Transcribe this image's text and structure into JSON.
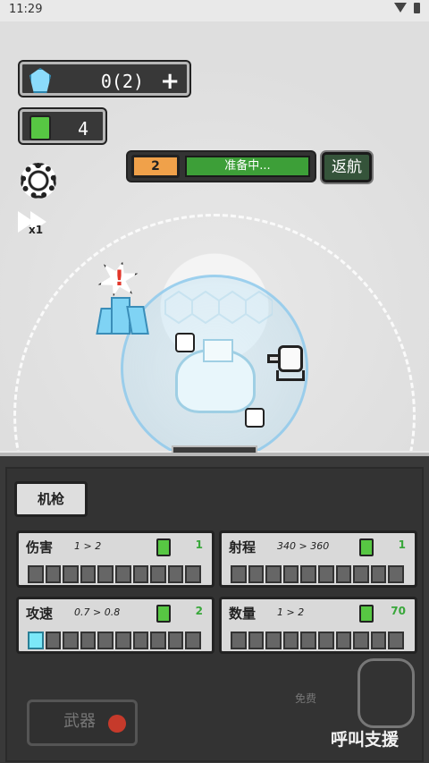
{
  "status_bar": {
    "time": "11:29"
  },
  "resources": {
    "crystal_value": "0(2)",
    "plus": "+",
    "can_value": "4"
  },
  "wave": {
    "number": "2",
    "status": "准备中..."
  },
  "return_button": "返航",
  "speed_label": "x1",
  "lower_panel": {
    "weapon_tab": "机枪",
    "stats": [
      {
        "name": "伤害",
        "change": "1 > 2",
        "cost": "1",
        "filled": 0
      },
      {
        "name": "射程",
        "change": "340 > 360",
        "cost": "1",
        "filled": 0
      },
      {
        "name": "攻速",
        "change": "0.7 > 0.8",
        "cost": "2",
        "filled": 1
      },
      {
        "name": "数量",
        "change": "1 > 2",
        "cost": "70",
        "filled": 0
      }
    ],
    "weapons_button": "武器",
    "free_label": "免费",
    "support_label": "呼叫支援"
  },
  "icons": [
    "crystal-icon",
    "can-icon",
    "gear-icon",
    "speed-icon",
    "alert-icon",
    "soldier-icon"
  ]
}
